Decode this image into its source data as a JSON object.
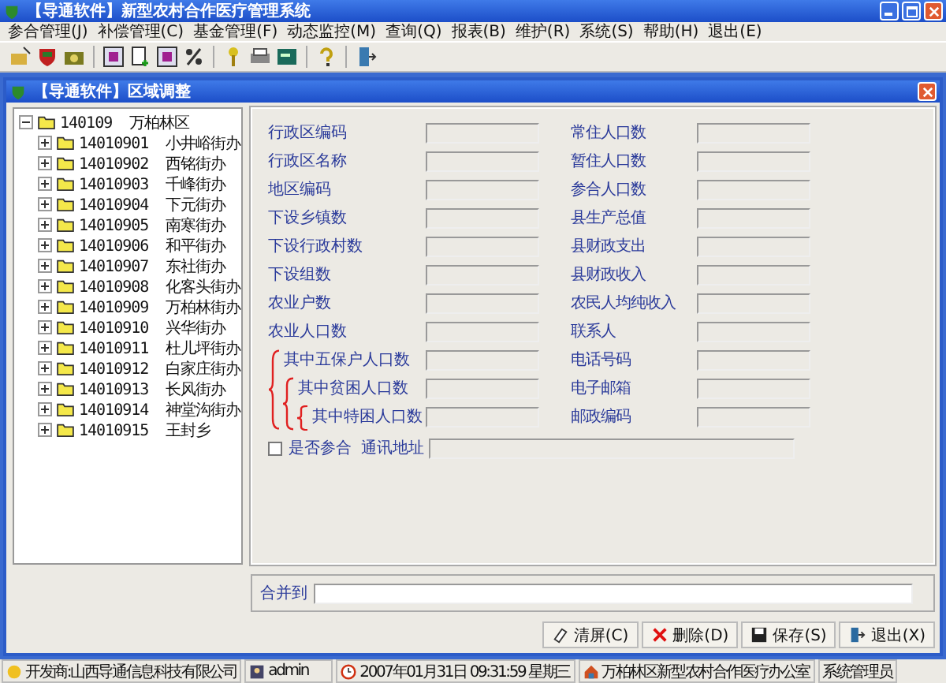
{
  "window": {
    "title": "【导通软件】新型农村合作医疗管理系统"
  },
  "menu": [
    "参合管理(J)",
    "补偿管理(C)",
    "基金管理(F)",
    "动态监控(M)",
    "查询(Q)",
    "报表(B)",
    "维护(R)",
    "系统(S)",
    "帮助(H)",
    "退出(E)"
  ],
  "child_window": {
    "title": "【导通软件】区域调整"
  },
  "tree": {
    "code": "140109",
    "name": "万柏林区",
    "expanded": true,
    "children": [
      {
        "code": "14010901",
        "name": "小井峪街办",
        "expanded": false
      },
      {
        "code": "14010902",
        "name": "西铭街办",
        "expanded": false
      },
      {
        "code": "14010903",
        "name": "千峰街办",
        "expanded": false
      },
      {
        "code": "14010904",
        "name": "下元街办",
        "expanded": false
      },
      {
        "code": "14010905",
        "name": "南寒街办",
        "expanded": false
      },
      {
        "code": "14010906",
        "name": "和平街办",
        "expanded": false
      },
      {
        "code": "14010907",
        "name": "东社街办",
        "expanded": false
      },
      {
        "code": "14010908",
        "name": "化客头街办",
        "expanded": false
      },
      {
        "code": "14010909",
        "name": "万柏林街办",
        "expanded": false
      },
      {
        "code": "14010910",
        "name": "兴华街办",
        "expanded": false
      },
      {
        "code": "14010911",
        "name": "杜儿坪街办",
        "expanded": false
      },
      {
        "code": "14010912",
        "name": "白家庄街办",
        "expanded": false
      },
      {
        "code": "14010913",
        "name": "长风街办",
        "expanded": false
      },
      {
        "code": "14010914",
        "name": "神堂沟街办",
        "expanded": false
      },
      {
        "code": "14010915",
        "name": "王封乡",
        "expanded": false
      }
    ]
  },
  "form": {
    "left_fields": [
      {
        "label": "行政区编码"
      },
      {
        "label": "行政区名称"
      },
      {
        "label": "地区编码"
      },
      {
        "label": "下设乡镇数"
      },
      {
        "label": "下设行政村数"
      },
      {
        "label": "下设组数"
      },
      {
        "label": "农业户数"
      },
      {
        "label": "农业人口数"
      },
      {
        "label": "其中五保户人口数",
        "children": [
          {
            "label": "其中贫困人口数",
            "children": [
              {
                "label": "其中特困人口数"
              }
            ]
          }
        ]
      }
    ],
    "right_fields": [
      {
        "label": "常住人口数"
      },
      {
        "label": "暂住人口数"
      },
      {
        "label": "参合人口数"
      },
      {
        "label": "县生产总值"
      },
      {
        "label": "县财政支出"
      },
      {
        "label": "县财政收入"
      },
      {
        "label": "农民人均纯收入"
      },
      {
        "label": "联系人"
      },
      {
        "label": "电话号码"
      },
      {
        "label": "电子邮箱"
      },
      {
        "label": "邮政编码"
      }
    ],
    "participate": {
      "label": "是否参合",
      "checked": false
    },
    "address": {
      "label": "通讯地址"
    }
  },
  "merge": {
    "label": "合并到"
  },
  "buttons": [
    {
      "label": "清屏(C)",
      "kind": "clear"
    },
    {
      "label": "删除(D)",
      "kind": "delete"
    },
    {
      "label": "保存(S)",
      "kind": "save"
    },
    {
      "label": "退出(X)",
      "kind": "exit"
    }
  ],
  "status_bar": [
    {
      "text": "开发商:山西导通信息科技有限公司",
      "kind": "developer"
    },
    {
      "text": "admin",
      "kind": "user"
    },
    {
      "text": "2007年01月31日 09:31:59 星期三",
      "kind": "clock"
    },
    {
      "text": "万柏林区新型农村合作医疗办公室",
      "kind": "office"
    },
    {
      "text": "系统管理员",
      "kind": "plain"
    }
  ]
}
